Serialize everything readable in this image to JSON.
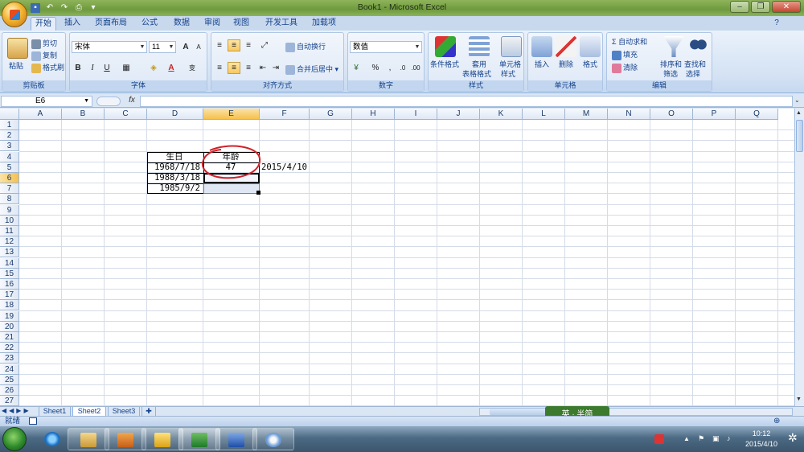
{
  "window": {
    "title": "Book1 - Microsoft Excel",
    "controls": {
      "minimize": "–",
      "restore": "❐",
      "close": "✕"
    }
  },
  "quick_access": {
    "save_icon": "save-icon",
    "undo_icon": "undo-icon",
    "redo_icon": "redo-icon"
  },
  "tabs": [
    {
      "label": "开始",
      "active": true
    },
    {
      "label": "插入"
    },
    {
      "label": "页面布局"
    },
    {
      "label": "公式"
    },
    {
      "label": "数据"
    },
    {
      "label": "审阅"
    },
    {
      "label": "视图"
    },
    {
      "label": "开发工具"
    },
    {
      "label": "加载项"
    }
  ],
  "ribbon": {
    "clipboard": {
      "label": "剪贴板",
      "paste": "粘贴",
      "cut": "剪切",
      "copy": "复制",
      "format_painter": "格式刷"
    },
    "font": {
      "label": "字体",
      "font_name": "宋体",
      "font_size": "11",
      "bold": "B",
      "italic": "I",
      "underline": "U",
      "grow": "A",
      "shrink": "A",
      "phonetic": "变"
    },
    "alignment": {
      "label": "对齐方式",
      "wrap_text": "自动换行",
      "merge_center": "合并后居中"
    },
    "number": {
      "label": "数字",
      "format": "数值",
      "percent": "%",
      "comma": ","
    },
    "styles": {
      "label": "样式",
      "conditional": "条件格式",
      "table_line1": "套用",
      "table_line2": "表格格式",
      "cell_styles_line1": "单元格",
      "cell_styles_line2": "样式"
    },
    "cells": {
      "label": "单元格",
      "insert": "插入",
      "delete": "删除",
      "format": "格式"
    },
    "editing": {
      "label": "编辑",
      "autosum": "Σ 自动求和",
      "fill": "填充",
      "clear": "清除",
      "sort_line1": "排序和",
      "sort_line2": "筛选",
      "find_line1": "查找和",
      "find_line2": "选择"
    }
  },
  "formula_bar": {
    "name_box": "E6",
    "fx": "fx",
    "value": ""
  },
  "columns": [
    "A",
    "B",
    "C",
    "D",
    "E",
    "F",
    "G",
    "H",
    "I",
    "J",
    "K",
    "L",
    "M",
    "N",
    "O",
    "P",
    "Q"
  ],
  "selected_column": "E",
  "rows": [
    "1",
    "2",
    "3",
    "4",
    "5",
    "6",
    "7",
    "8",
    "9",
    "10",
    "11",
    "12",
    "13",
    "14",
    "15",
    "16",
    "17",
    "18",
    "19",
    "20",
    "21",
    "22",
    "23",
    "24",
    "25",
    "26",
    "27"
  ],
  "selected_row": "6",
  "cells": {
    "D4": "生日",
    "E4": "年龄",
    "D5": "1968/7/18",
    "E5": "47",
    "F5": "2015/4/10",
    "D6": "1988/3/18",
    "D7": "1985/9/2"
  },
  "sheet_tabs": [
    "Sheet1",
    "Sheet2",
    "Sheet3"
  ],
  "active_sheet": "Sheet2",
  "status": {
    "ready": "就绪"
  },
  "watermark": "英 · 半简",
  "taskbar": {
    "time": "10:12",
    "date": "2015/4/10"
  },
  "colors": {
    "annotation_red": "#d0202a",
    "selection_orange": "#f5c04f"
  }
}
